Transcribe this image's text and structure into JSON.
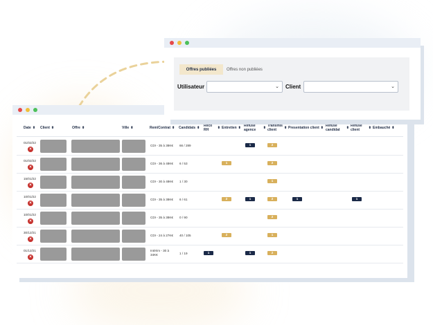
{
  "offers_window": {
    "tabs": [
      {
        "label": "Offres publiées",
        "active": true
      },
      {
        "label": "Offres non publiées",
        "active": false
      }
    ],
    "filters": {
      "user_label": "Utilisateur",
      "client_label": "Client"
    }
  },
  "table": {
    "columns": [
      "Date",
      "Client",
      "Offre",
      "Ville",
      "Rem/Contrat",
      "Candidats",
      "Reco RH",
      "Entretien",
      "Refusé agence",
      "Transmis client",
      "Presentation client",
      "Refusé candidat",
      "Refusé client",
      "Embauché"
    ],
    "rows": [
      {
        "date": "01/02/22",
        "contract": "CDI - 35 à 38K€",
        "candidates": "66 / 289",
        "badges": [
          {
            "col": "refuse_agence",
            "value": "1",
            "color": "navy"
          },
          {
            "col": "transmis",
            "value": "2",
            "color": "gold"
          }
        ]
      },
      {
        "date": "01/02/22",
        "contract": "CDI - 36 à 48K€",
        "candidates": "6 / 53",
        "badges": [
          {
            "col": "entretien",
            "value": "1",
            "color": "gold"
          },
          {
            "col": "transmis",
            "value": "2",
            "color": "gold"
          }
        ]
      },
      {
        "date": "15/01/22",
        "contract": "CDI - 30 à 48K€",
        "candidates": "1 / 30",
        "badges": [
          {
            "col": "transmis",
            "value": "1",
            "color": "gold"
          }
        ]
      },
      {
        "date": "10/01/22",
        "contract": "CDI - 35 à 38K€",
        "candidates": "6 / 61",
        "badges": [
          {
            "col": "entretien",
            "value": "2",
            "color": "gold"
          },
          {
            "col": "refuse_agence",
            "value": "1",
            "color": "navy"
          },
          {
            "col": "transmis",
            "value": "2",
            "color": "gold"
          },
          {
            "col": "presentation",
            "value": "1",
            "color": "navy"
          },
          {
            "col": "refuse_client",
            "value": "1",
            "color": "navy"
          }
        ]
      },
      {
        "date": "10/01/22",
        "contract": "CDI - 35 à 38K€",
        "candidates": "0 / 90",
        "badges": [
          {
            "col": "transmis",
            "value": "2",
            "color": "gold"
          }
        ]
      },
      {
        "date": "30/12/21",
        "contract": "CDI - 24 à 27K€",
        "candidates": "40 / 105",
        "badges": [
          {
            "col": "entretien",
            "value": "2",
            "color": "gold"
          },
          {
            "col": "transmis",
            "value": "1",
            "color": "gold"
          }
        ]
      },
      {
        "date": "01/12/21",
        "contract": "Intérim - 30 à 34K€",
        "candidates": "1 / 19",
        "badges": [
          {
            "col": "reco",
            "value": "1",
            "color": "navy"
          },
          {
            "col": "refuse_agence",
            "value": "1",
            "color": "navy"
          },
          {
            "col": "transmis",
            "value": "2",
            "color": "gold"
          }
        ]
      }
    ]
  },
  "colors": {
    "gold_badge": "#d8b05c",
    "navy_badge": "#1b2a48",
    "delete_icon": "#c6322e",
    "tab_active_bg": "#f3e7cc"
  }
}
